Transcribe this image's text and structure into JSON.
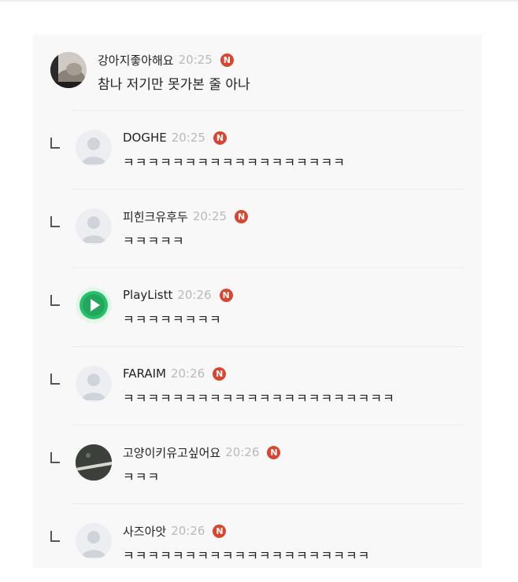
{
  "comments": [
    {
      "author": "강아지좋아해요",
      "time": "20:25",
      "badge": "N",
      "text": "참나 저기만 못가본 줄 아나",
      "reply": false,
      "avatar": "photo-avatar-dog"
    },
    {
      "author": "DOGHE",
      "time": "20:25",
      "badge": "N",
      "text": "ㅋㅋㅋㅋㅋㅋㅋㅋㅋㅋㅋㅋㅋㅋㅋㅋㅋㅋ",
      "reply": true,
      "avatar": "default-avatar"
    },
    {
      "author": "피힌크유후두",
      "time": "20:25",
      "badge": "N",
      "text": "ㅋㅋㅋㅋㅋ",
      "reply": true,
      "avatar": "default-avatar"
    },
    {
      "author": "PlayListt",
      "time": "20:26",
      "badge": "N",
      "text": "ㅋㅋㅋㅋㅋㅋㅋㅋ",
      "reply": true,
      "avatar": "play-button-avatar"
    },
    {
      "author": "FARAIM",
      "time": "20:26",
      "badge": "N",
      "text": "ㅋㅋㅋㅋㅋㅋㅋㅋㅋㅋㅋㅋㅋㅋㅋㅋㅋㅋㅋㅋㅋㅋ",
      "reply": true,
      "avatar": "default-avatar"
    },
    {
      "author": "고양이키유고싶어요",
      "time": "20:26",
      "badge": "N",
      "text": "ㅋㅋㅋ",
      "reply": true,
      "avatar": "photo-avatar-dark"
    },
    {
      "author": "사즈아앗",
      "time": "20:26",
      "badge": "N",
      "text": "ㅋㅋㅋㅋㅋㅋㅋㅋㅋㅋㅋㅋㅋㅋㅋㅋㅋㅋㅋㅋ",
      "reply": true,
      "avatar": "default-avatar"
    }
  ],
  "colors": {
    "badge": "#d9452e",
    "time": "#b9b9b9",
    "play_green": "#27c06b"
  }
}
